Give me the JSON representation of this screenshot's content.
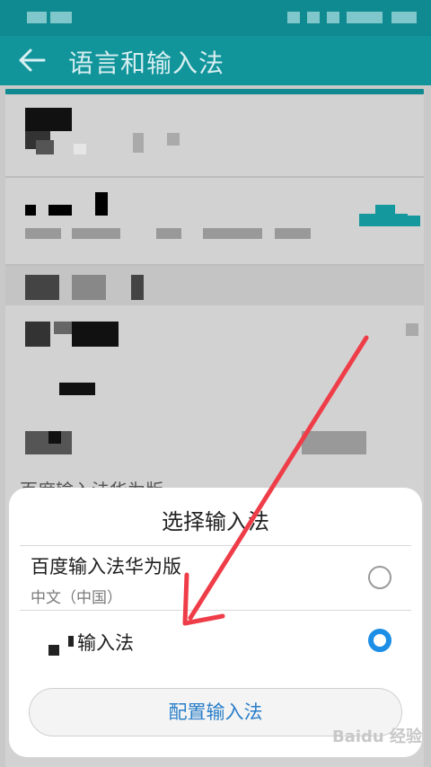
{
  "toolbar": {
    "title": "语言和输入法"
  },
  "background": {
    "partial_item_text": "百度输入法华为版"
  },
  "dialog": {
    "title": "选择输入法",
    "options": [
      {
        "label": "百度输入法华为版",
        "sublabel": "中文（中国）",
        "selected": false
      },
      {
        "label": "输入法",
        "selected": true
      }
    ],
    "config_button": "配置输入法"
  },
  "watermark": "Baidu 经验",
  "colors": {
    "teal": "#11959b",
    "accent_blue": "#1c8ee6",
    "arrow_red": "#ee3d48"
  }
}
